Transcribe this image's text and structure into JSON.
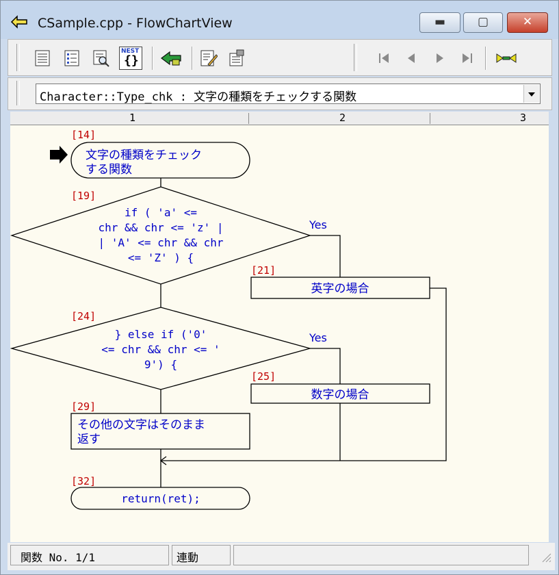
{
  "window": {
    "title": "CSample.cpp - FlowChartView",
    "controls": {
      "minimize": "▭",
      "maximize": "▢",
      "close": "✕"
    }
  },
  "toolbar": {
    "left_icons": [
      "list-icon",
      "detail-icon",
      "search-icon",
      "nest-icon",
      "house-arrow-icon",
      "edit-icon",
      "properties-icon"
    ],
    "nest_label": "NEST",
    "nest_braces": "{}",
    "nav_icons": [
      "first-icon",
      "prev-icon",
      "next-icon",
      "last-icon",
      "sync-icon"
    ]
  },
  "function_select": {
    "value": "Character::Type_chk : 文字の種類をチェックする関数"
  },
  "ruler": {
    "columns": [
      "1",
      "2",
      "3"
    ]
  },
  "flowchart": {
    "nodes": {
      "start": {
        "line": "[14]",
        "text1": "文字の種類をチェック",
        "text2": "する関数"
      },
      "if1": {
        "line": "[19]",
        "t1": "if ( 'a' <=",
        "t2": "chr && chr <= 'z' |",
        "t3": "| 'A' <= chr && chr",
        "t4": "<= 'Z' ) {"
      },
      "p21": {
        "line": "[21]",
        "text": "英字の場合"
      },
      "if2": {
        "line": "[24]",
        "t1": "} else if ('0'",
        "t2": "<= chr && chr <= '",
        "t3": "9') {"
      },
      "p25": {
        "line": "[25]",
        "text": "数字の場合"
      },
      "p29": {
        "line": "[29]",
        "text1": "その他の文字はそのまま",
        "text2": "返す"
      },
      "end": {
        "line": "[32]",
        "text": "return(ret);"
      }
    },
    "yes_label": "Yes",
    "colors": {
      "line_number": "#c00000",
      "node_text": "#0000c8",
      "line": "#000000",
      "background": "#fdfbf0"
    }
  },
  "status": {
    "position": "関数 No. 1/1",
    "mode": "連動",
    "extra": ""
  }
}
